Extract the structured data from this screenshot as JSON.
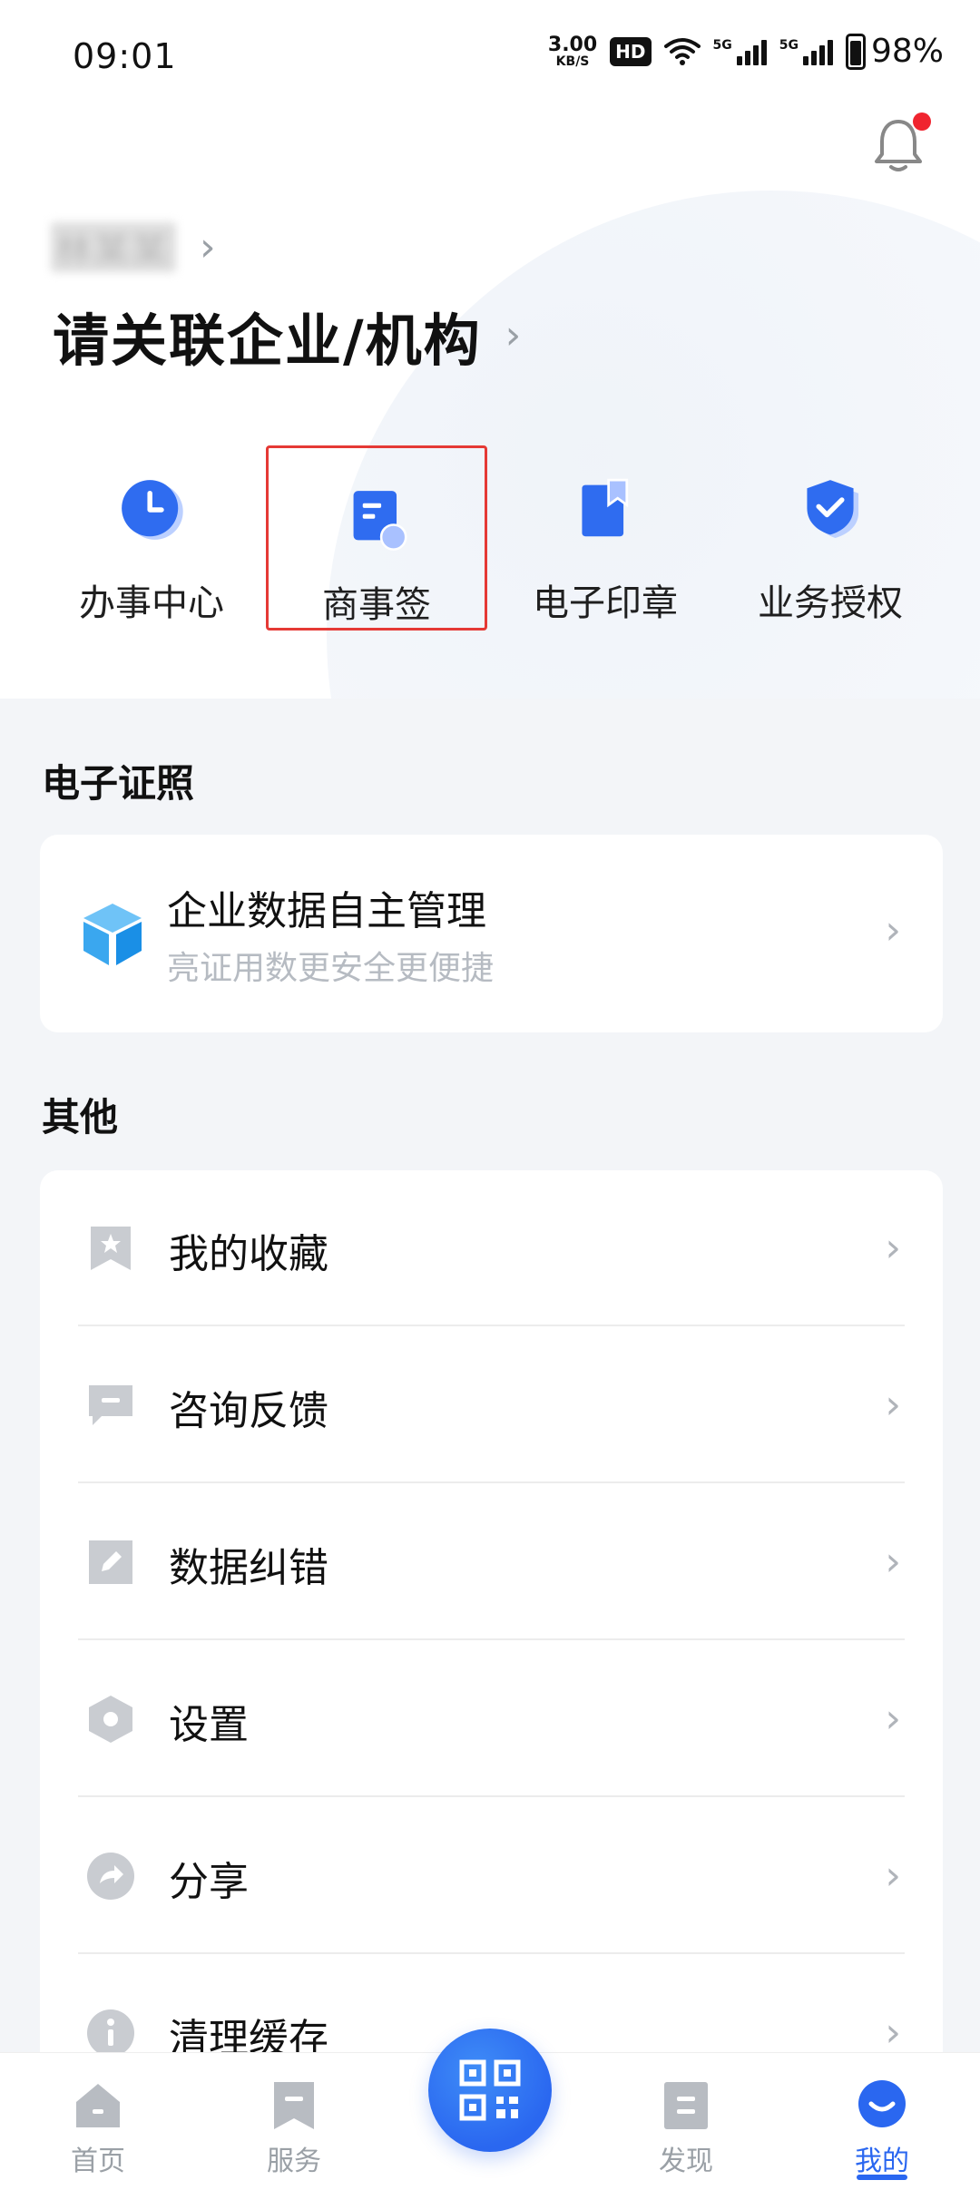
{
  "status_bar": {
    "time": "09:01",
    "net_speed_value": "3.00",
    "net_speed_unit": "KB/S",
    "hd_label": "HD",
    "signal_5g_1": "5G",
    "signal_5g_2": "5G",
    "battery": "98%"
  },
  "header": {
    "user_name": "林某某",
    "org_title": "请关联企业/机构",
    "notification": {
      "has_dot": true,
      "dot_color": "#f0242f"
    }
  },
  "quick_actions": [
    {
      "label": "办事中心",
      "icon": "clock-icon"
    },
    {
      "label": "商事签",
      "icon": "document-sign-icon",
      "highlighted": true
    },
    {
      "label": "电子印章",
      "icon": "bookmark-seal-icon"
    },
    {
      "label": "业务授权",
      "icon": "shield-check-icon"
    }
  ],
  "sections": {
    "cert_title": "电子证照",
    "cert_card": {
      "title": "企业数据自主管理",
      "subtitle": "亮证用数更安全更便捷",
      "icon": "cube-icon"
    },
    "other_title": "其他",
    "other_items": [
      {
        "label": "我的收藏",
        "icon": "star-bookmark-icon"
      },
      {
        "label": "咨询反馈",
        "icon": "chat-icon"
      },
      {
        "label": "数据纠错",
        "icon": "edit-icon"
      },
      {
        "label": "设置",
        "icon": "hexagon-settings-icon"
      },
      {
        "label": "分享",
        "icon": "share-icon"
      },
      {
        "label": "清理缓存",
        "icon": "info-icon"
      }
    ]
  },
  "bottom_nav": [
    {
      "label": "首页",
      "icon": "home-icon"
    },
    {
      "label": "服务",
      "icon": "service-icon"
    },
    {
      "label": "发现",
      "icon": "discover-icon"
    },
    {
      "label": "我的",
      "icon": "profile-icon",
      "active": true
    }
  ],
  "colors": {
    "accent": "#2a67f0",
    "highlight_border": "#e53935"
  }
}
